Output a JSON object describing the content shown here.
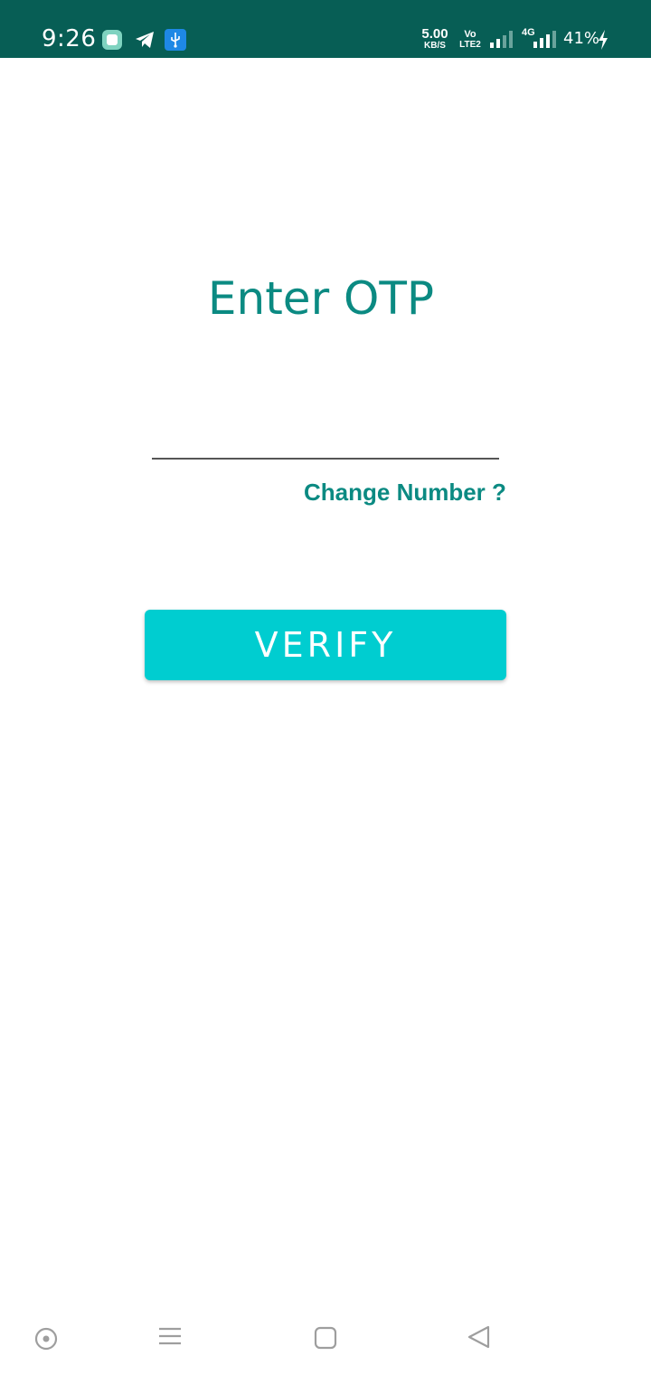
{
  "status_bar": {
    "time": "9:26",
    "net_speed_value": "5.00",
    "net_speed_unit": "KB/S",
    "volte_top": "Vo",
    "volte_bottom": "LTE2",
    "network_type": "4G",
    "battery": "41%",
    "icons": [
      "app-icon",
      "telegram-icon",
      "usb-icon",
      "signal-icon",
      "signal-icon",
      "charging-icon"
    ]
  },
  "main": {
    "title": "Enter OTP",
    "otp_value": "",
    "change_number": "Change Number ?",
    "verify_label": "VERIFY"
  },
  "nav_bar": {
    "icons": [
      "assistant-icon",
      "menu-icon",
      "home-icon",
      "back-icon"
    ]
  },
  "colors": {
    "status_bar": "#075e55",
    "accent": "#0b8a82",
    "button": "#00cdd0"
  }
}
